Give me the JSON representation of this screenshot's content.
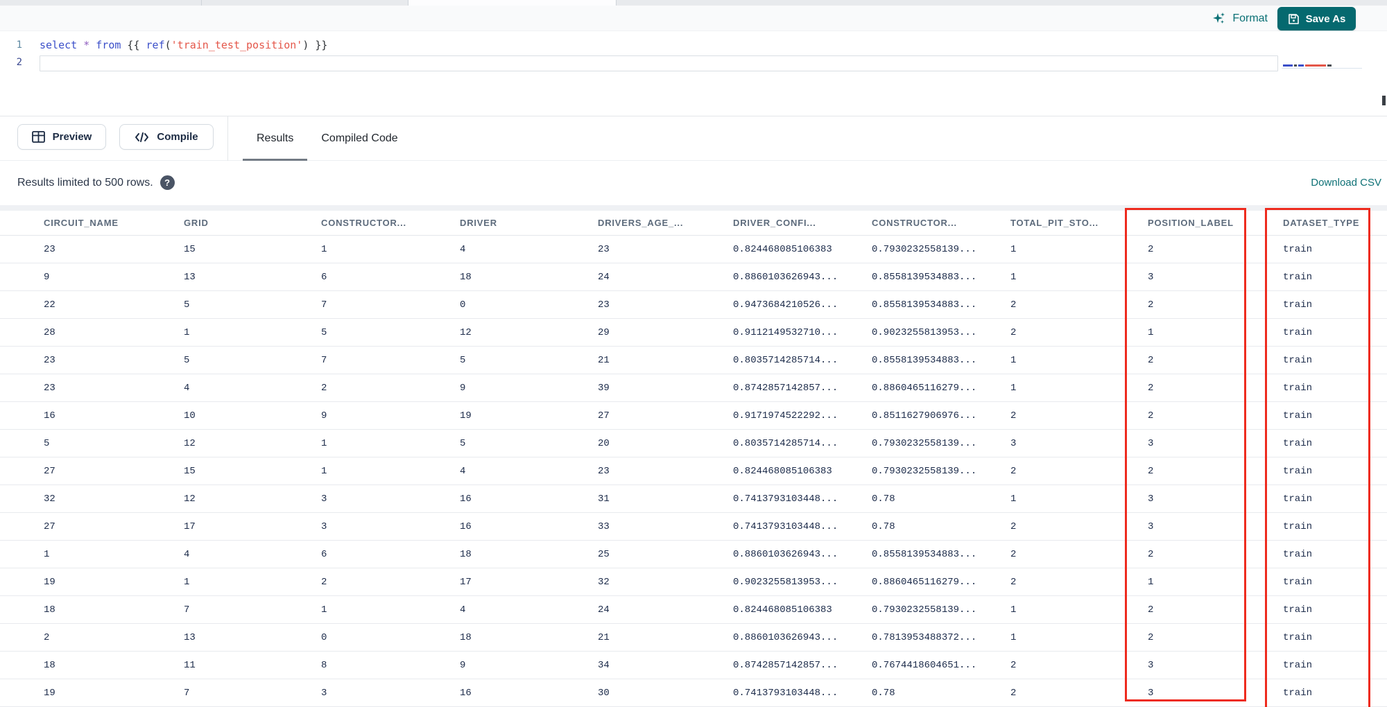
{
  "toolbar": {
    "format_label": "Format",
    "save_as_label": "Save As"
  },
  "editor": {
    "line_numbers": [
      "1",
      "2"
    ],
    "code_tokens": [
      {
        "text": "select",
        "type": "keyword"
      },
      {
        "text": " ",
        "type": "plain"
      },
      {
        "text": "*",
        "type": "operator"
      },
      {
        "text": " ",
        "type": "plain"
      },
      {
        "text": "from",
        "type": "keyword"
      },
      {
        "text": " {{ ",
        "type": "plain"
      },
      {
        "text": "ref",
        "type": "keyword"
      },
      {
        "text": "(",
        "type": "plain"
      },
      {
        "text": "'train_test_position'",
        "type": "string"
      },
      {
        "text": ") }}",
        "type": "plain"
      }
    ]
  },
  "actions": {
    "preview_label": "Preview",
    "compile_label": "Compile"
  },
  "tabs": [
    {
      "label": "Results",
      "active": true
    },
    {
      "label": "Compiled Code",
      "active": false
    }
  ],
  "results_bar": {
    "limit_text": "Results limited to 500 rows.",
    "help_icon": "?",
    "download_label": "Download CSV"
  },
  "table": {
    "columns": [
      "CIRCUIT_NAME",
      "GRID",
      "CONSTRUCTOR...",
      "DRIVER",
      "DRIVERS_AGE_...",
      "DRIVER_CONFI...",
      "CONSTRUCTOR...",
      "TOTAL_PIT_STO...",
      "POSITION_LABEL",
      "DATASET_TYPE"
    ],
    "rows": [
      [
        "23",
        "15",
        "1",
        "4",
        "23",
        "0.824468085106383",
        "0.7930232558139...",
        "1",
        "2",
        "train"
      ],
      [
        "9",
        "13",
        "6",
        "18",
        "24",
        "0.8860103626943...",
        "0.8558139534883...",
        "1",
        "3",
        "train"
      ],
      [
        "22",
        "5",
        "7",
        "0",
        "23",
        "0.9473684210526...",
        "0.8558139534883...",
        "2",
        "2",
        "train"
      ],
      [
        "28",
        "1",
        "5",
        "12",
        "29",
        "0.9112149532710...",
        "0.9023255813953...",
        "2",
        "1",
        "train"
      ],
      [
        "23",
        "5",
        "7",
        "5",
        "21",
        "0.8035714285714...",
        "0.8558139534883...",
        "1",
        "2",
        "train"
      ],
      [
        "23",
        "4",
        "2",
        "9",
        "39",
        "0.8742857142857...",
        "0.8860465116279...",
        "1",
        "2",
        "train"
      ],
      [
        "16",
        "10",
        "9",
        "19",
        "27",
        "0.9171974522292...",
        "0.8511627906976...",
        "2",
        "2",
        "train"
      ],
      [
        "5",
        "12",
        "1",
        "5",
        "20",
        "0.8035714285714...",
        "0.7930232558139...",
        "3",
        "3",
        "train"
      ],
      [
        "27",
        "15",
        "1",
        "4",
        "23",
        "0.824468085106383",
        "0.7930232558139...",
        "2",
        "2",
        "train"
      ],
      [
        "32",
        "12",
        "3",
        "16",
        "31",
        "0.7413793103448...",
        "0.78",
        "1",
        "3",
        "train"
      ],
      [
        "27",
        "17",
        "3",
        "16",
        "33",
        "0.7413793103448...",
        "0.78",
        "2",
        "3",
        "train"
      ],
      [
        "1",
        "4",
        "6",
        "18",
        "25",
        "0.8860103626943...",
        "0.8558139534883...",
        "2",
        "2",
        "train"
      ],
      [
        "19",
        "1",
        "2",
        "17",
        "32",
        "0.9023255813953...",
        "0.8860465116279...",
        "2",
        "1",
        "train"
      ],
      [
        "18",
        "7",
        "1",
        "4",
        "24",
        "0.824468085106383",
        "0.7930232558139...",
        "1",
        "2",
        "train"
      ],
      [
        "2",
        "13",
        "0",
        "18",
        "21",
        "0.8860103626943...",
        "0.7813953488372...",
        "1",
        "2",
        "train"
      ],
      [
        "18",
        "11",
        "8",
        "9",
        "34",
        "0.8742857142857...",
        "0.7674418604651...",
        "2",
        "3",
        "train"
      ],
      [
        "19",
        "7",
        "3",
        "16",
        "30",
        "0.7413793103448...",
        "0.78",
        "2",
        "3",
        "train"
      ]
    ],
    "highlighted_columns": [
      "POSITION_LABEL",
      "DATASET_TYPE"
    ]
  },
  "colors": {
    "accent_teal": "#05696f",
    "link_teal": "#0e7176",
    "highlight_red": "#ee2b1e",
    "keyword_blue": "#3b4fc9",
    "string_red": "#e45649",
    "operator_purple": "#9160c0"
  }
}
